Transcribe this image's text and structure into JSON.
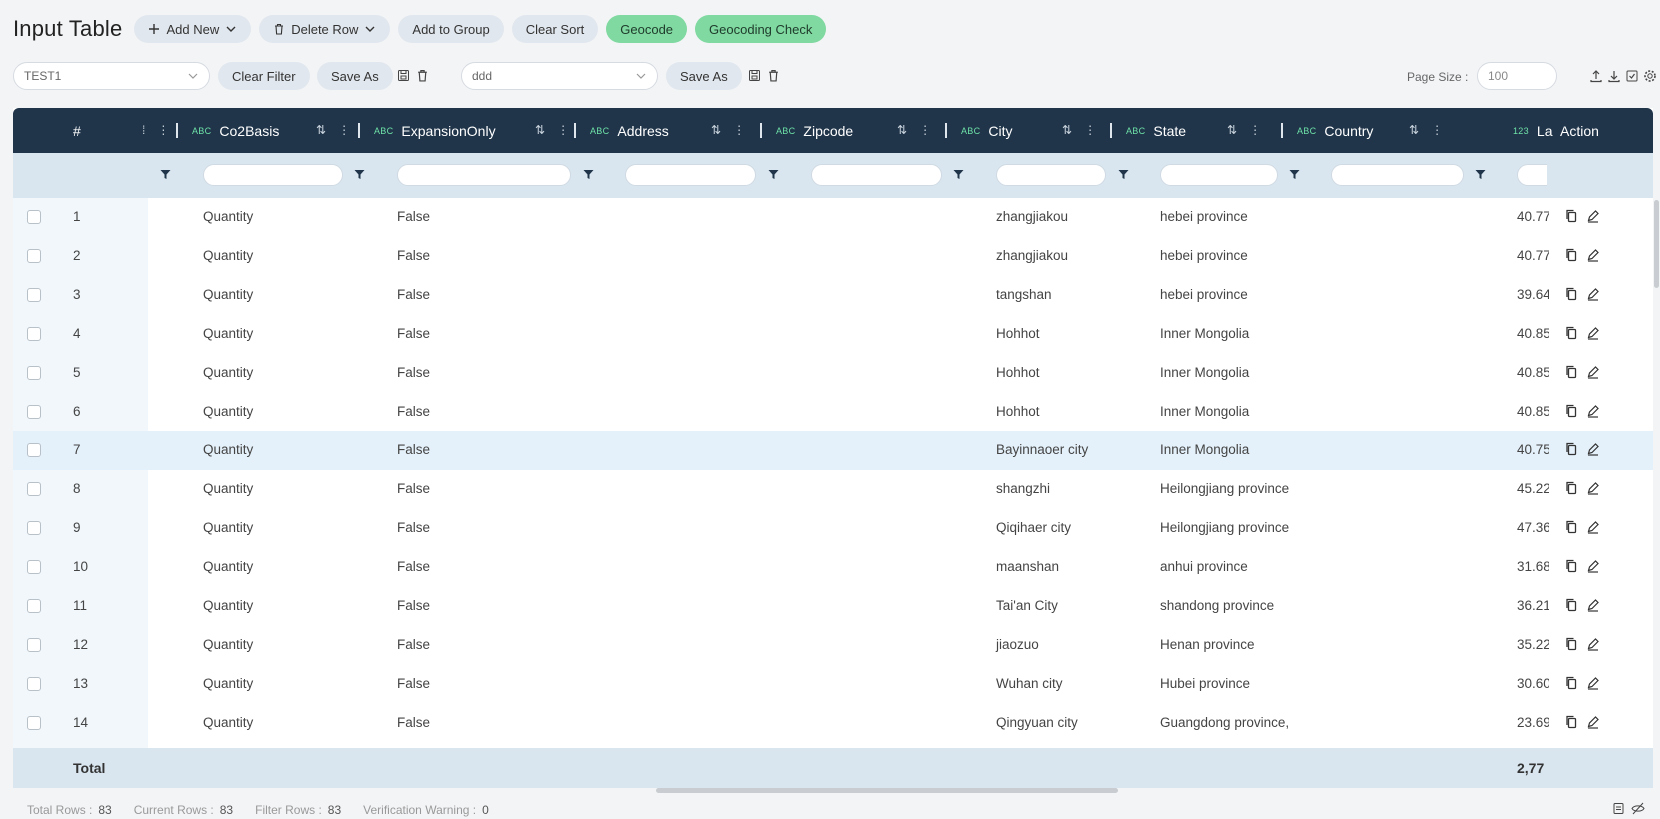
{
  "toolbar": {
    "title": "Input Table",
    "add_new": "Add New",
    "delete_row": "Delete Row",
    "add_to_group": "Add to Group",
    "clear_sort": "Clear Sort",
    "geocode": "Geocode",
    "geocoding_check": "Geocoding Check"
  },
  "filterbar": {
    "filter_select": "TEST1",
    "clear_filter": "Clear Filter",
    "save_as_1": "Save As",
    "view_select": "ddd",
    "save_as_2": "Save As",
    "page_size_label": "Page Size :",
    "page_size_value": "100"
  },
  "columns": {
    "index": "#",
    "co2basis": "Co2Basis",
    "expansion": "ExpansionOnly",
    "address": "Address",
    "zipcode": "Zipcode",
    "city": "City",
    "state": "State",
    "country": "Country",
    "lat": "La",
    "action": "Action",
    "type_text": "ABC",
    "type_num": "123"
  },
  "rows": [
    {
      "n": "1",
      "co2": "Quantity",
      "exp": "False",
      "city": "zhangjiakou",
      "state": "hebei province",
      "lat": "40.77"
    },
    {
      "n": "2",
      "co2": "Quantity",
      "exp": "False",
      "city": "zhangjiakou",
      "state": "hebei province",
      "lat": "40.77"
    },
    {
      "n": "3",
      "co2": "Quantity",
      "exp": "False",
      "city": "tangshan",
      "state": "hebei province",
      "lat": "39.64"
    },
    {
      "n": "4",
      "co2": "Quantity",
      "exp": "False",
      "city": "Hohhot",
      "state": "Inner Mongolia",
      "lat": "40.85"
    },
    {
      "n": "5",
      "co2": "Quantity",
      "exp": "False",
      "city": "Hohhot",
      "state": "Inner Mongolia",
      "lat": "40.85"
    },
    {
      "n": "6",
      "co2": "Quantity",
      "exp": "False",
      "city": "Hohhot",
      "state": "Inner Mongolia",
      "lat": "40.85"
    },
    {
      "n": "7",
      "co2": "Quantity",
      "exp": "False",
      "city": "Bayinnaoer city",
      "state": "Inner Mongolia",
      "lat": "40.75"
    },
    {
      "n": "8",
      "co2": "Quantity",
      "exp": "False",
      "city": "shangzhi",
      "state": "Heilongjiang province",
      "lat": "45.22"
    },
    {
      "n": "9",
      "co2": "Quantity",
      "exp": "False",
      "city": "Qiqihaer city",
      "state": "Heilongjiang province",
      "lat": "47.36"
    },
    {
      "n": "10",
      "co2": "Quantity",
      "exp": "False",
      "city": "maanshan",
      "state": "anhui province",
      "lat": "31.68"
    },
    {
      "n": "11",
      "co2": "Quantity",
      "exp": "False",
      "city": "Tai'an City",
      "state": "shandong province",
      "lat": "36.21"
    },
    {
      "n": "12",
      "co2": "Quantity",
      "exp": "False",
      "city": "jiaozuo",
      "state": "Henan province",
      "lat": "35.22"
    },
    {
      "n": "13",
      "co2": "Quantity",
      "exp": "False",
      "city": "Wuhan city",
      "state": "Hubei province",
      "lat": "30.60"
    },
    {
      "n": "14",
      "co2": "Quantity",
      "exp": "False",
      "city": "Qingyuan city",
      "state": "Guangdong province,",
      "lat": "23.69"
    }
  ],
  "total": {
    "label": "Total",
    "lat": "2,77"
  },
  "footer": {
    "total_rows_label": "Total Rows :",
    "total_rows": "83",
    "current_rows_label": "Current Rows :",
    "current_rows": "83",
    "filter_rows_label": "Filter Rows :",
    "filter_rows": "83",
    "warning_label": "Verification Warning :",
    "warning": "0"
  },
  "colors": {
    "header": "#20354a",
    "accent_green": "#7fd9a0",
    "filter_row": "#d9e6ef",
    "selected_row": "#e4f1fa"
  }
}
